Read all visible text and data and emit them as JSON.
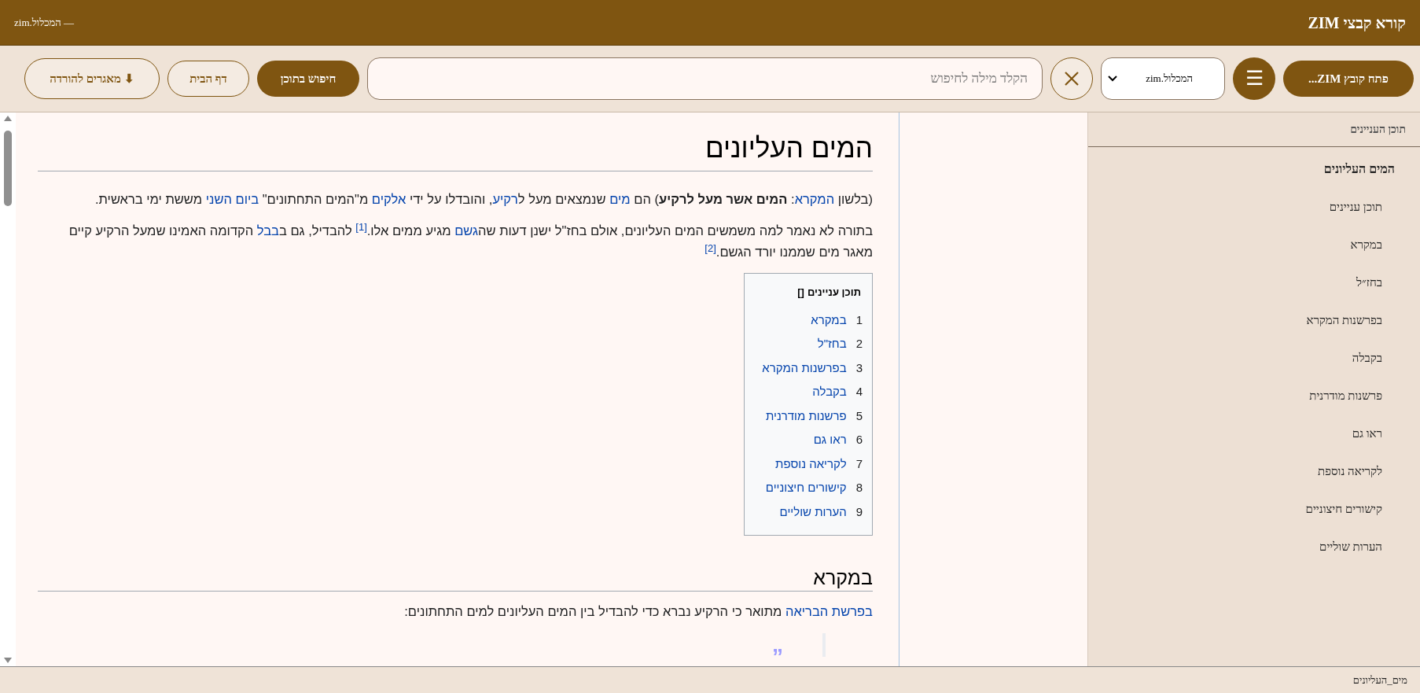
{
  "window": {
    "title": "קורא קבצי ZIM",
    "subtitle": "— המכלול.zim"
  },
  "toolbar": {
    "open_button": "פתח קובץ ZIM...",
    "menu_icon": "☰",
    "file_select": "המכלול.zim",
    "search": {
      "placeholder": "הקלד מילה לחיפוש"
    },
    "search_button": "חיפוש בתוכן",
    "home_button": "דף הבית",
    "download_button": {
      "icon": "⬇",
      "label": "מאגרים להורדה"
    }
  },
  "sidebar": {
    "title": "תוכן העניינים",
    "items": [
      {
        "label": "המים העליונים",
        "children": [
          {
            "label": "תוכן עניינים"
          },
          {
            "label": "במקרא"
          },
          {
            "label": "בחז״ל"
          },
          {
            "label": "בפרשנות המקרא"
          },
          {
            "label": "בקבלה"
          },
          {
            "label": "פרשנות מודרנית"
          },
          {
            "label": "ראו גם"
          },
          {
            "label": "לקריאה נוספת"
          },
          {
            "label": "קישורים חיצוניים"
          },
          {
            "label": "הערות שוליים"
          }
        ]
      }
    ]
  },
  "article": {
    "title": "המים העליונים",
    "paragraphs": [
      [
        {
          "kind": "text",
          "text": "(בלשון "
        },
        {
          "kind": "link",
          "text": "המקרא"
        },
        {
          "kind": "text",
          "text": ": "
        },
        {
          "kind": "bold",
          "text": "המים אשר מעל לרקיע"
        },
        {
          "kind": "text",
          "text": ") הם "
        },
        {
          "kind": "link",
          "text": "מים"
        },
        {
          "kind": "text",
          "text": " שנמצאים מעל ל"
        },
        {
          "kind": "link",
          "text": "רקיע"
        },
        {
          "kind": "text",
          "text": ", והובדלו על ידי "
        },
        {
          "kind": "link",
          "text": "אלקים"
        },
        {
          "kind": "text",
          "text": " מ\"המים התחתונים\" "
        },
        {
          "kind": "link",
          "text": "ביום השני"
        },
        {
          "kind": "text",
          "text": " מששת ימי בראשית."
        }
      ],
      [
        {
          "kind": "text",
          "text": "בתורה לא נאמר למה משמשים המים העליונים, אולם בחז\"ל ישנן דעות שה"
        },
        {
          "kind": "link",
          "text": "גשם"
        },
        {
          "kind": "text",
          "text": " מגיע ממים אלו."
        },
        {
          "kind": "ref",
          "text": "[1]"
        },
        {
          "kind": "text",
          "text": " להבדיל, גם ב"
        },
        {
          "kind": "link",
          "text": "בבל"
        },
        {
          "kind": "text",
          "text": " הקדומה האמינו שמעל הרקיע קיים מאגר מים שממנו יורד הגשם."
        },
        {
          "kind": "ref",
          "text": "[2]"
        }
      ]
    ],
    "toc": {
      "title": "תוכן עניינים",
      "toggle": "[]",
      "items": [
        {
          "number": "1",
          "label": "במקרא"
        },
        {
          "number": "2",
          "label": "בחז\"ל"
        },
        {
          "number": "3",
          "label": "בפרשנות המקרא"
        },
        {
          "number": "4",
          "label": "בקבלה"
        },
        {
          "number": "5",
          "label": "פרשנות מודרנית"
        },
        {
          "number": "6",
          "label": "ראו גם"
        },
        {
          "number": "7",
          "label": "לקריאה נוספת"
        },
        {
          "number": "8",
          "label": "קישורים חיצוניים"
        },
        {
          "number": "9",
          "label": "הערות שוליים"
        }
      ]
    },
    "sections": [
      {
        "heading": "במקרא",
        "paragraphs": [
          [
            {
              "kind": "link",
              "text": "בפרשת הבריאה"
            },
            {
              "kind": "text",
              "text": " מתואר כי הרקיע נברא כדי להבדיל בין המים העליונים למים התחתונים:"
            }
          ]
        ],
        "quote_mark": "”"
      }
    ]
  },
  "status_bar": {
    "text": "מים_העליונים"
  }
}
